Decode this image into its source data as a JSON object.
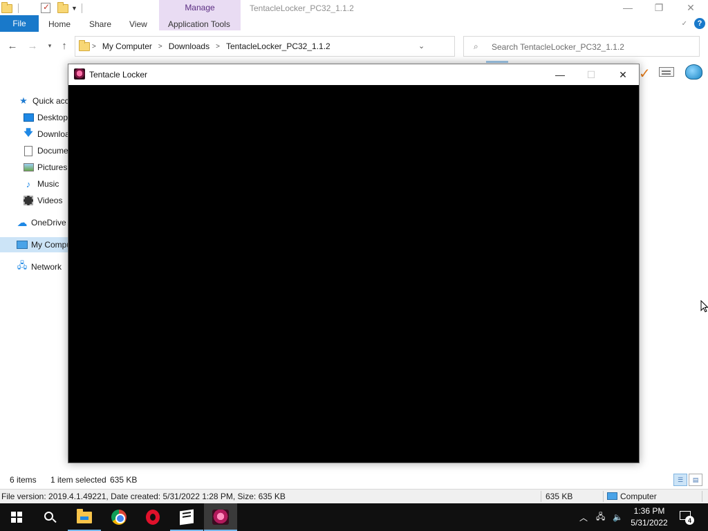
{
  "explorer": {
    "window_title": "TentacleLocker_PC32_1.1.2",
    "ribbon": {
      "context_group_label": "Manage",
      "tabs": [
        "File",
        "Home",
        "Share",
        "View",
        "Application Tools"
      ]
    },
    "address_bar": {
      "crumbs": [
        "My Computer",
        "Downloads",
        "TentacleLocker_PC32_1.1.2"
      ]
    },
    "search": {
      "placeholder": "Search TentacleLocker_PC32_1.1.2"
    },
    "nav_pane": {
      "items": [
        {
          "label": "Quick access",
          "icon": "star-icon"
        },
        {
          "label": "Desktop",
          "icon": "desktop-icon"
        },
        {
          "label": "Downloads",
          "icon": "download-icon"
        },
        {
          "label": "Documents",
          "icon": "document-icon"
        },
        {
          "label": "Pictures",
          "icon": "pictures-icon"
        },
        {
          "label": "Music",
          "icon": "music-icon"
        },
        {
          "label": "Videos",
          "icon": "videos-icon"
        },
        {
          "label": "OneDrive",
          "icon": "cloud-icon"
        },
        {
          "label": "My Computer",
          "icon": "computer-icon",
          "selected": true
        },
        {
          "label": "Network",
          "icon": "network-icon"
        }
      ]
    },
    "status": {
      "item_count": "6 items",
      "selection": "1 item selected",
      "selection_size": "635 KB"
    },
    "details_bar": {
      "file_info": "File version: 2019.4.1.49221, Date created: 5/31/2022 1:28 PM, Size: 635 KB",
      "size": "635 KB",
      "location": "Computer"
    }
  },
  "app_window": {
    "title": "Tentacle Locker",
    "content_color": "#000000"
  },
  "taskbar": {
    "apps": [
      "start-icon",
      "search-icon",
      "file-explorer-icon",
      "chrome-icon",
      "opera-icon",
      "package-icon",
      "tentacle-locker-icon"
    ],
    "clock": {
      "time": "1:36 PM",
      "date": "5/31/2022"
    },
    "notification_count": "4"
  },
  "colors": {
    "accent": "#1979ca",
    "manage_tab": "#e9dcf3",
    "taskbar": "#101010",
    "selection": "#cce4f7"
  }
}
